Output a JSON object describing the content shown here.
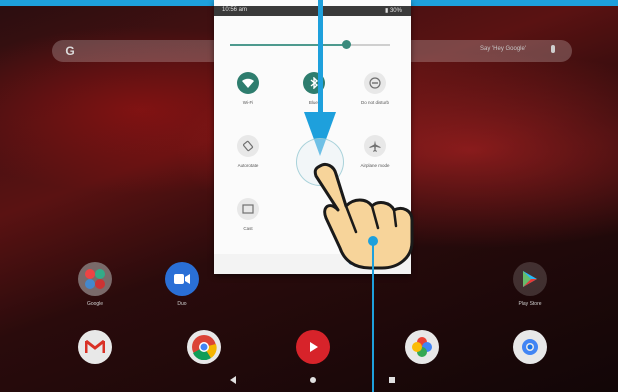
{
  "status_bar": {
    "time": "10:56 am",
    "battery": "▮ 30%"
  },
  "search": {
    "say_hey": "Say 'Hey Google'",
    "logo": "G"
  },
  "brightness": {
    "level_percent": 73
  },
  "quick_settings": {
    "tiles": [
      {
        "label": "Wi-Fi",
        "icon": "wifi-icon",
        "active": true
      },
      {
        "label": "Bluet",
        "icon": "bluetooth-icon",
        "active": true
      },
      {
        "label": "Do not disturb",
        "icon": "dnd-icon",
        "active": false
      },
      {
        "label": "Autorotate",
        "icon": "autorotate-icon",
        "active": false
      },
      {
        "label": "Airplane mode",
        "icon": "airplane-icon",
        "active": false
      },
      {
        "label": "Cast",
        "icon": "cast-icon",
        "active": false
      }
    ]
  },
  "apps": [
    {
      "label": "Google",
      "icon": "google-folder-icon"
    },
    {
      "label": "Duo",
      "icon": "duo-icon"
    },
    {
      "label": "Play Store",
      "icon": "play-store-icon"
    }
  ],
  "dock": [
    {
      "icon": "gmail-icon"
    },
    {
      "icon": "chrome-icon"
    },
    {
      "icon": "youtube-icon"
    },
    {
      "icon": "photos-icon"
    },
    {
      "icon": "camera-icon"
    }
  ],
  "colors": {
    "accent": "#1ea0dc",
    "tile_on": "#2e7d6e"
  }
}
